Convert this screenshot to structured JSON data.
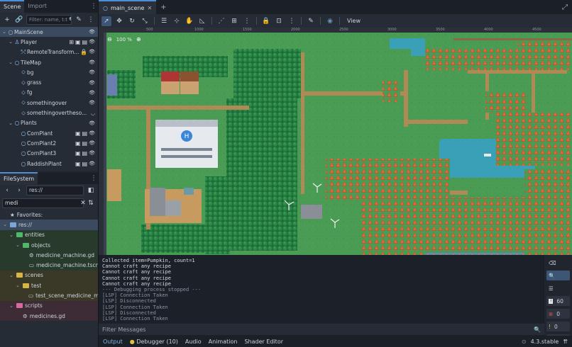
{
  "left_dock": {
    "tabs": [
      "Scene",
      "Import"
    ],
    "filter_placeholder": "Filter: name, t:t",
    "scene_tree": [
      {
        "label": "MainScene",
        "depth": 0,
        "icon": "node-icon",
        "selected": true
      },
      {
        "label": "Player",
        "depth": 1,
        "icon": "body-icon"
      },
      {
        "label": "RemoteTransform...",
        "depth": 2,
        "icon": "transform-icon"
      },
      {
        "label": "TileMap",
        "depth": 1,
        "icon": "tilemap-icon"
      },
      {
        "label": "bg",
        "depth": 2,
        "icon": "layer-icon"
      },
      {
        "label": "grass",
        "depth": 2,
        "icon": "layer-icon"
      },
      {
        "label": "fg",
        "depth": 2,
        "icon": "layer-icon"
      },
      {
        "label": "somethingover",
        "depth": 2,
        "icon": "layer-icon"
      },
      {
        "label": "somethingovertheso...",
        "depth": 2,
        "icon": "layer-icon"
      },
      {
        "label": "Plants",
        "depth": 1,
        "icon": "node-icon"
      },
      {
        "label": "CornPlant",
        "depth": 2,
        "icon": "node-icon"
      },
      {
        "label": "CornPlant2",
        "depth": 2,
        "icon": "node-icon"
      },
      {
        "label": "CornPlant3",
        "depth": 2,
        "icon": "node-icon"
      },
      {
        "label": "RaddishPlant",
        "depth": 2,
        "icon": "node-icon"
      }
    ],
    "filesystem": {
      "title": "FileSystem",
      "path": "res://",
      "search_value": "medi",
      "items": [
        {
          "label": "Favorites:",
          "depth": 0,
          "kind": "fav"
        },
        {
          "label": "res://",
          "depth": 0,
          "kind": "root"
        },
        {
          "label": "entities",
          "depth": 1,
          "kind": "folder",
          "color": "#4fb86a"
        },
        {
          "label": "objects",
          "depth": 2,
          "kind": "folder",
          "color": "#4fb86a"
        },
        {
          "label": "medicine_machine.gd",
          "depth": 3,
          "kind": "script"
        },
        {
          "label": "medicine_machine.tscn",
          "depth": 3,
          "kind": "scene"
        },
        {
          "label": "scenes",
          "depth": 1,
          "kind": "folder",
          "color": "#d6b646"
        },
        {
          "label": "test",
          "depth": 2,
          "kind": "folder",
          "color": "#d6b646"
        },
        {
          "label": "test_scene_medicine_ma...",
          "depth": 3,
          "kind": "scene"
        },
        {
          "label": "scripts",
          "depth": 1,
          "kind": "folder",
          "color": "#d66aa0"
        },
        {
          "label": "medicines.gd",
          "depth": 2,
          "kind": "script"
        }
      ]
    }
  },
  "editor": {
    "scene_tab": "main_scene",
    "view_label": "View",
    "zoom_label": "100 %",
    "ruler_labels": [
      "500",
      "1000",
      "1500",
      "2000",
      "2500",
      "3000",
      "3500",
      "4000",
      "4500"
    ]
  },
  "output": {
    "lines": [
      "Collected item=Pumpkin, count=1",
      "Cannot craft any recipe",
      "Cannot craft any recipe",
      "Cannot craft any recipe",
      "Cannot craft any recipe",
      "--- Debugging process stopped ---",
      "[LSP] Connection Taken",
      "[LSP] Disconnected",
      "[LSP] Connection Taken",
      "[LSP] Disconnected",
      "[LSP] Connection Taken"
    ],
    "filter_placeholder": "Filter Messages",
    "counts": {
      "messages": "60",
      "errors": "0",
      "warnings": "0",
      "info": "6"
    }
  },
  "bottom_panel": {
    "tabs": [
      "Output",
      "Debugger (10)",
      "Audio",
      "Animation",
      "Shader Editor"
    ],
    "version": "4.3.stable"
  },
  "colors": {
    "accent": "#4f8fd8",
    "grass": "#4a9c55",
    "water": "#3aa0b8",
    "autumn": "#c2552e",
    "path": "#b08a55"
  }
}
